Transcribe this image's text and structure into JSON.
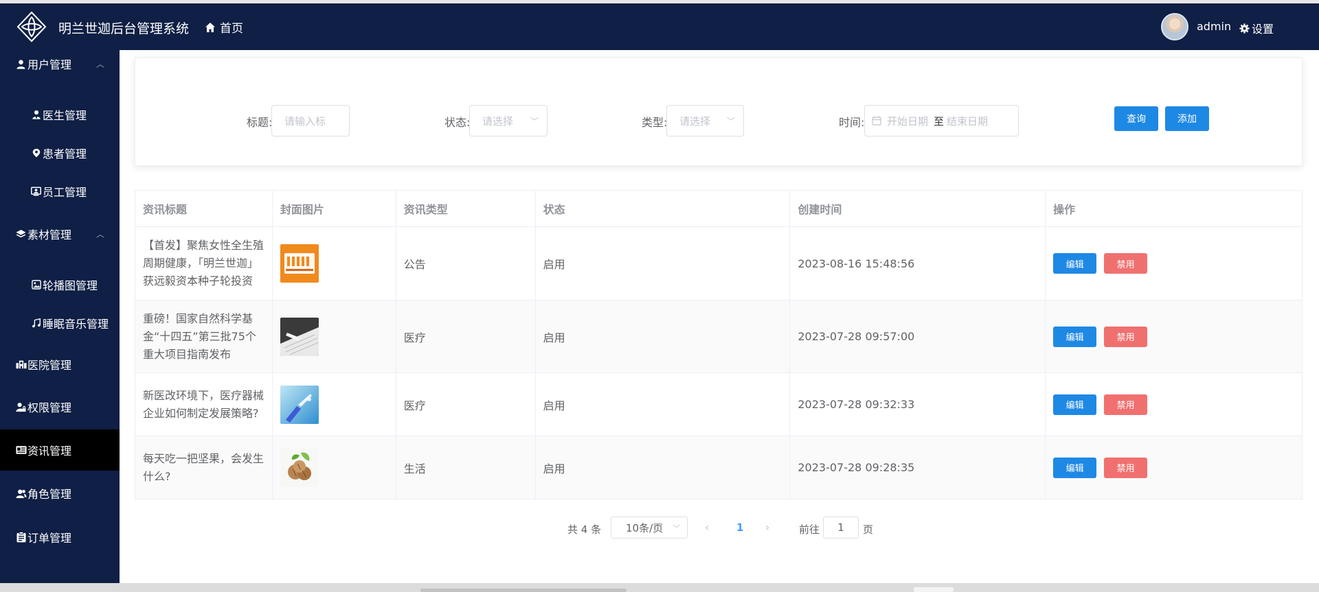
{
  "header": {
    "app_title": "明兰世迦后台管理系统",
    "home_label": "首页",
    "username": "admin",
    "settings_label": "设置"
  },
  "sidebar": {
    "items": [
      {
        "label": "用户管理",
        "icon": "user-icon",
        "expanded": true
      },
      {
        "label": "医生管理",
        "icon": "doctor-icon"
      },
      {
        "label": "患者管理",
        "icon": "location-icon"
      },
      {
        "label": "员工管理",
        "icon": "id-card-icon"
      },
      {
        "label": "素材管理",
        "icon": "layers-icon",
        "expanded": true
      },
      {
        "label": "轮播图管理",
        "icon": "image-icon"
      },
      {
        "label": "睡眠音乐管理",
        "icon": "music-icon"
      },
      {
        "label": "医院管理",
        "icon": "building-icon"
      },
      {
        "label": "权限管理",
        "icon": "user-lock-icon"
      },
      {
        "label": "资讯管理",
        "icon": "news-icon",
        "active": true
      },
      {
        "label": "角色管理",
        "icon": "users-icon"
      },
      {
        "label": "订单管理",
        "icon": "clipboard-icon"
      }
    ]
  },
  "filters": {
    "title_label": "标题:",
    "title_placeholder": "请输入标",
    "status_label": "状态:",
    "status_placeholder": "请选择",
    "type_label": "类型:",
    "type_placeholder": "请选择",
    "time_label": "时间:",
    "start_placeholder": "开始日期",
    "range_separator": "至",
    "end_placeholder": "结束日期",
    "query_label": "查询",
    "add_label": "添加"
  },
  "table": {
    "columns": [
      "资讯标题",
      "封面图片",
      "资讯类型",
      "状态",
      "创建时间",
      "操作"
    ],
    "rows": [
      {
        "title": "【首发】聚焦女性全生殖周期健康，「明兰世迦」获远毅资本种子轮投资",
        "cover": "cover-orange",
        "type": "公告",
        "status": "启用",
        "created": "2023-08-16 15:48:56",
        "edit": "编辑",
        "disable": "禁用"
      },
      {
        "title": "重磅！国家自然科学基金“十四五”第三批75个重大项目指南发布",
        "cover": "cover-keyboard",
        "type": "医疗",
        "status": "启用",
        "created": "2023-07-28 09:57:00",
        "edit": "编辑",
        "disable": "禁用"
      },
      {
        "title": "新医改环境下，医疗器械企业如何制定发展策略?",
        "cover": "cover-blue",
        "type": "医疗",
        "status": "启用",
        "created": "2023-07-28 09:32:33",
        "edit": "编辑",
        "disable": "禁用"
      },
      {
        "title": "每天吃一把坚果，会发生什么?",
        "cover": "cover-walnut",
        "type": "生活",
        "status": "启用",
        "created": "2023-07-28 09:28:35",
        "edit": "编辑",
        "disable": "禁用"
      }
    ]
  },
  "pagination": {
    "total_text": "共 4 条",
    "page_size": "10条/页",
    "current_page": "1",
    "goto_label": "前往",
    "goto_value": "1",
    "goto_suffix": "页"
  },
  "colors": {
    "header_bg": "#0f1f45",
    "primary": "#1e88e5",
    "danger": "#f07070",
    "active_menu_bg": "#000000"
  }
}
